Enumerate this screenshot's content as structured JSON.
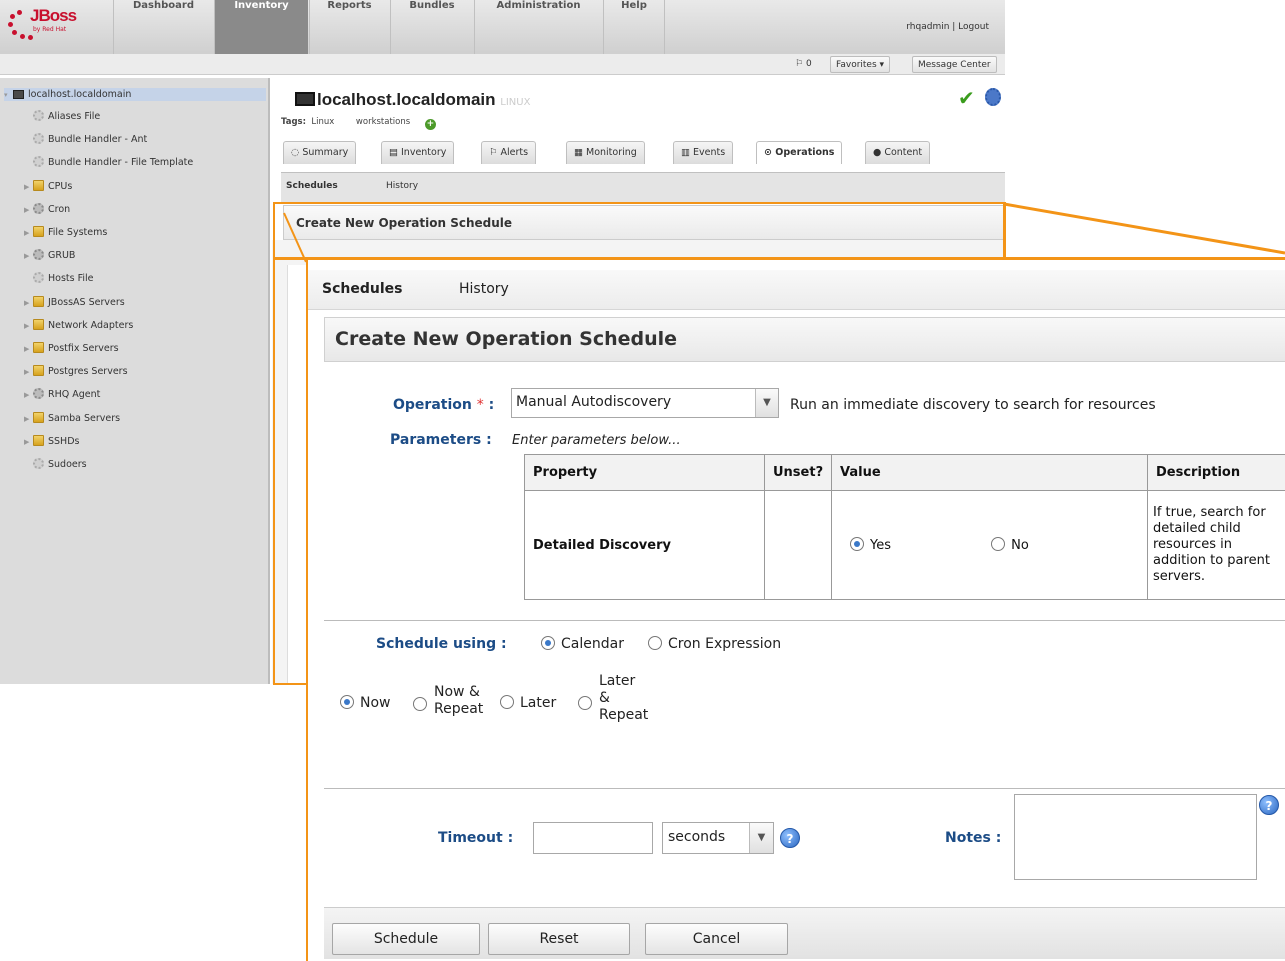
{
  "app": {
    "logo_text": "JBoss",
    "logo_sub": "by Red Hat",
    "nav": [
      "Dashboard",
      "Inventory",
      "Reports",
      "Bundles",
      "Administration",
      "Help"
    ],
    "active_nav": "Inventory",
    "user": "rhqadmin | Logout",
    "flag_count": "0",
    "favorites": "Favorites ▾",
    "message_center": "Message Center"
  },
  "sidebar": {
    "root": "localhost.localdomain",
    "items": [
      {
        "label": "Aliases File",
        "icon": "gear-icon"
      },
      {
        "label": "Bundle Handler - Ant",
        "icon": "gear-icon"
      },
      {
        "label": "Bundle Handler - File Template",
        "icon": "gear-icon"
      },
      {
        "label": "CPUs",
        "icon": "folder-icon"
      },
      {
        "label": "Cron",
        "icon": "gears-icon"
      },
      {
        "label": "File Systems",
        "icon": "folder-icon"
      },
      {
        "label": "GRUB",
        "icon": "gears-icon"
      },
      {
        "label": "Hosts File",
        "icon": "gear-icon"
      },
      {
        "label": "JBossAS Servers",
        "icon": "folder-icon"
      },
      {
        "label": "Network Adapters",
        "icon": "folder-icon"
      },
      {
        "label": "Postfix Servers",
        "icon": "folder-icon"
      },
      {
        "label": "Postgres Servers",
        "icon": "folder-icon"
      },
      {
        "label": "RHQ Agent",
        "icon": "gears-icon"
      },
      {
        "label": "Samba Servers",
        "icon": "folder-icon"
      },
      {
        "label": "SSHDs",
        "icon": "folder-icon"
      },
      {
        "label": "Sudoers",
        "icon": "gear-icon"
      }
    ]
  },
  "resource": {
    "title": "localhost.localdomain",
    "type": "LINUX",
    "tags_label": "Tags:",
    "tags": [
      "Linux",
      "workstations"
    ],
    "tabs": [
      "Summary",
      "Inventory",
      "Alerts",
      "Monitoring",
      "Events",
      "Operations",
      "Content"
    ],
    "active_tab": "Operations"
  },
  "subtabs": {
    "schedules": "Schedules",
    "history": "History"
  },
  "form": {
    "header": "Create New Operation Schedule",
    "operation_label": "Operation",
    "required_mark": "*",
    "colon": ":",
    "operation_value": "Manual Autodiscovery",
    "operation_desc": "Run an immediate discovery to search for resources",
    "parameters_label": "Parameters :",
    "parameters_hint": "Enter parameters below...",
    "table": {
      "headers": [
        "Property",
        "Unset?",
        "Value",
        "Description"
      ],
      "row": {
        "property": "Detailed Discovery",
        "unset": "",
        "yes": "Yes",
        "no": "No",
        "selected": "Yes",
        "description": "If true, search for detailed child resources in addition to parent servers."
      }
    },
    "schedule_label": "Schedule using :",
    "schedule_options": [
      "Calendar",
      "Cron Expression"
    ],
    "schedule_selected": "Calendar",
    "when_options": [
      "Now",
      "Now &\nRepeat",
      "Later",
      "Later\n&\nRepeat"
    ],
    "when_selected": "Now",
    "timeout_label": "Timeout :",
    "timeout_value": "",
    "timeout_unit": "seconds",
    "notes_label": "Notes :",
    "notes_value": "",
    "buttons": {
      "schedule": "Schedule",
      "reset": "Reset",
      "cancel": "Cancel"
    }
  },
  "colors": {
    "accent": "#f39417",
    "label": "#1c4c86",
    "required": "#e03030"
  }
}
